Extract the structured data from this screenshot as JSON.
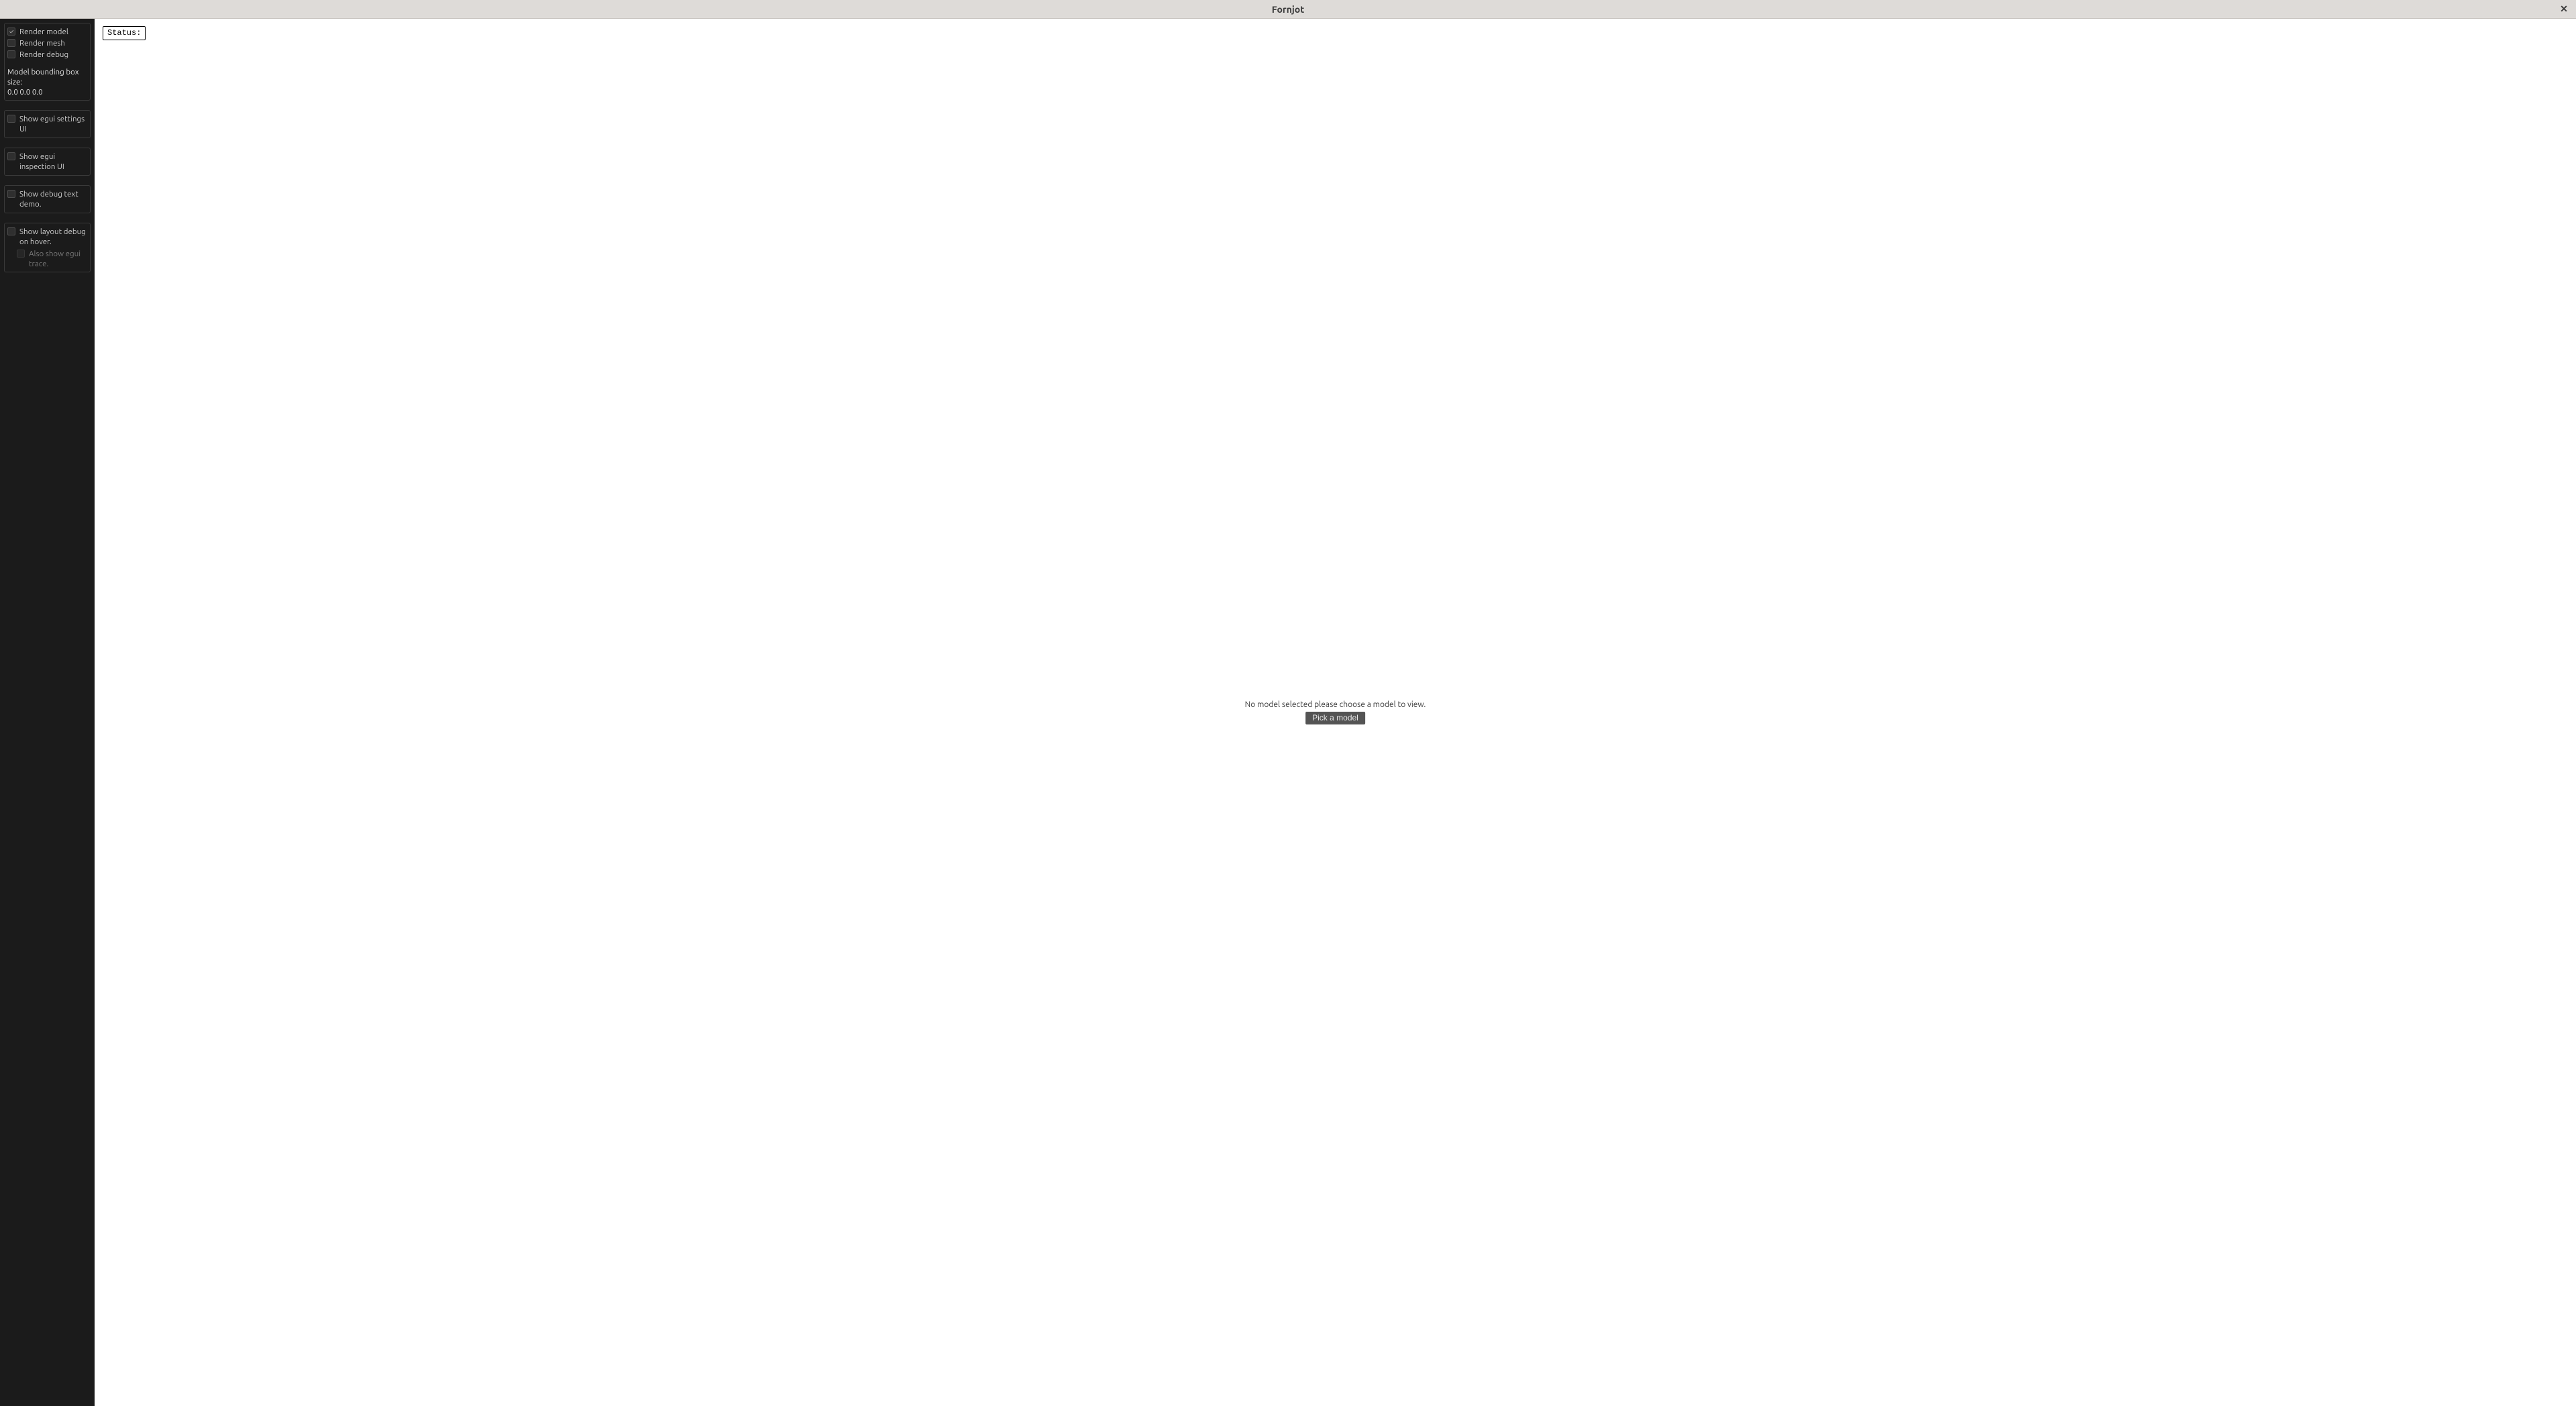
{
  "titlebar": {
    "title": "Fornjot"
  },
  "side": {
    "render_group": {
      "render_model": {
        "label": "Render model",
        "checked": true
      },
      "render_mesh": {
        "label": "Render mesh",
        "checked": false
      },
      "render_debug": {
        "label": "Render debug",
        "checked": false
      },
      "bbox_label": "Model bounding box size:",
      "bbox_value": "0.0 0.0 0.0"
    },
    "show_settings": {
      "label": "Show egui settings UI",
      "checked": false
    },
    "show_inspection": {
      "label": "Show egui inspection UI",
      "checked": false
    },
    "show_debug_text": {
      "label": "Show debug text demo.",
      "checked": false
    },
    "layout_debug": {
      "label": "Show layout debug on hover.",
      "checked": false,
      "trace_label": "Also show egui trace.",
      "trace_checked": false
    }
  },
  "viewport": {
    "status_label": "Status:",
    "no_model_message": "No model selected please choose a model to view.",
    "pick_button_label": "Pick a model"
  }
}
